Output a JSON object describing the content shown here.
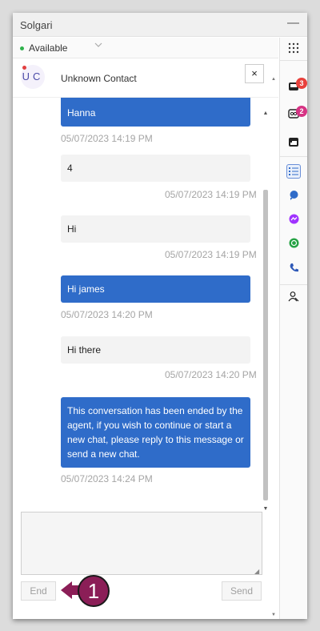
{
  "app": {
    "title": "Solgari",
    "minimize_glyph": "—"
  },
  "status": {
    "label": "Available",
    "dot_color": "#2fb24c"
  },
  "contact": {
    "initials": "UC",
    "name": "Unknown Contact",
    "close_glyph": "×"
  },
  "messages": [
    {
      "sender": "agent",
      "text": "Hanna",
      "timestamp": "05/07/2023 14:19 PM"
    },
    {
      "sender": "visitor",
      "text": "4",
      "timestamp": "05/07/2023 14:19 PM"
    },
    {
      "sender": "visitor",
      "text": "Hi",
      "timestamp": "05/07/2023 14:19 PM"
    },
    {
      "sender": "agent",
      "text": "Hi james",
      "timestamp": "05/07/2023 14:20 PM"
    },
    {
      "sender": "visitor",
      "text": "Hi there",
      "timestamp": "05/07/2023 14:20 PM"
    },
    {
      "sender": "agent",
      "text": "This conversation has been ended by the agent, if you wish to continue or start a new chat, please reply to this message or send a new chat.",
      "timestamp": "05/07/2023 14:24 PM"
    }
  ],
  "composer": {
    "value": "",
    "placeholder": ""
  },
  "buttons": {
    "end": "End",
    "send": "Send"
  },
  "sidebar": {
    "inbox_badge": "3",
    "voicemail_badge": "2",
    "badge_colors": {
      "inbox": "#e8413c",
      "voicemail": "#d63384"
    },
    "icons": [
      "dialpad-icon",
      "inbox-icon",
      "voicemail-icon",
      "calendar-icon",
      "task-list-icon",
      "chat-icon",
      "messenger-icon",
      "whatsapp-icon",
      "phone-icon",
      "contacts-icon"
    ]
  },
  "annotation": {
    "number": "1",
    "color": "#8b1e57"
  },
  "colors": {
    "agent_bubble": "#2f6cc9",
    "visitor_bubble": "#f3f3f3",
    "timestamp": "#a5a5a5"
  }
}
